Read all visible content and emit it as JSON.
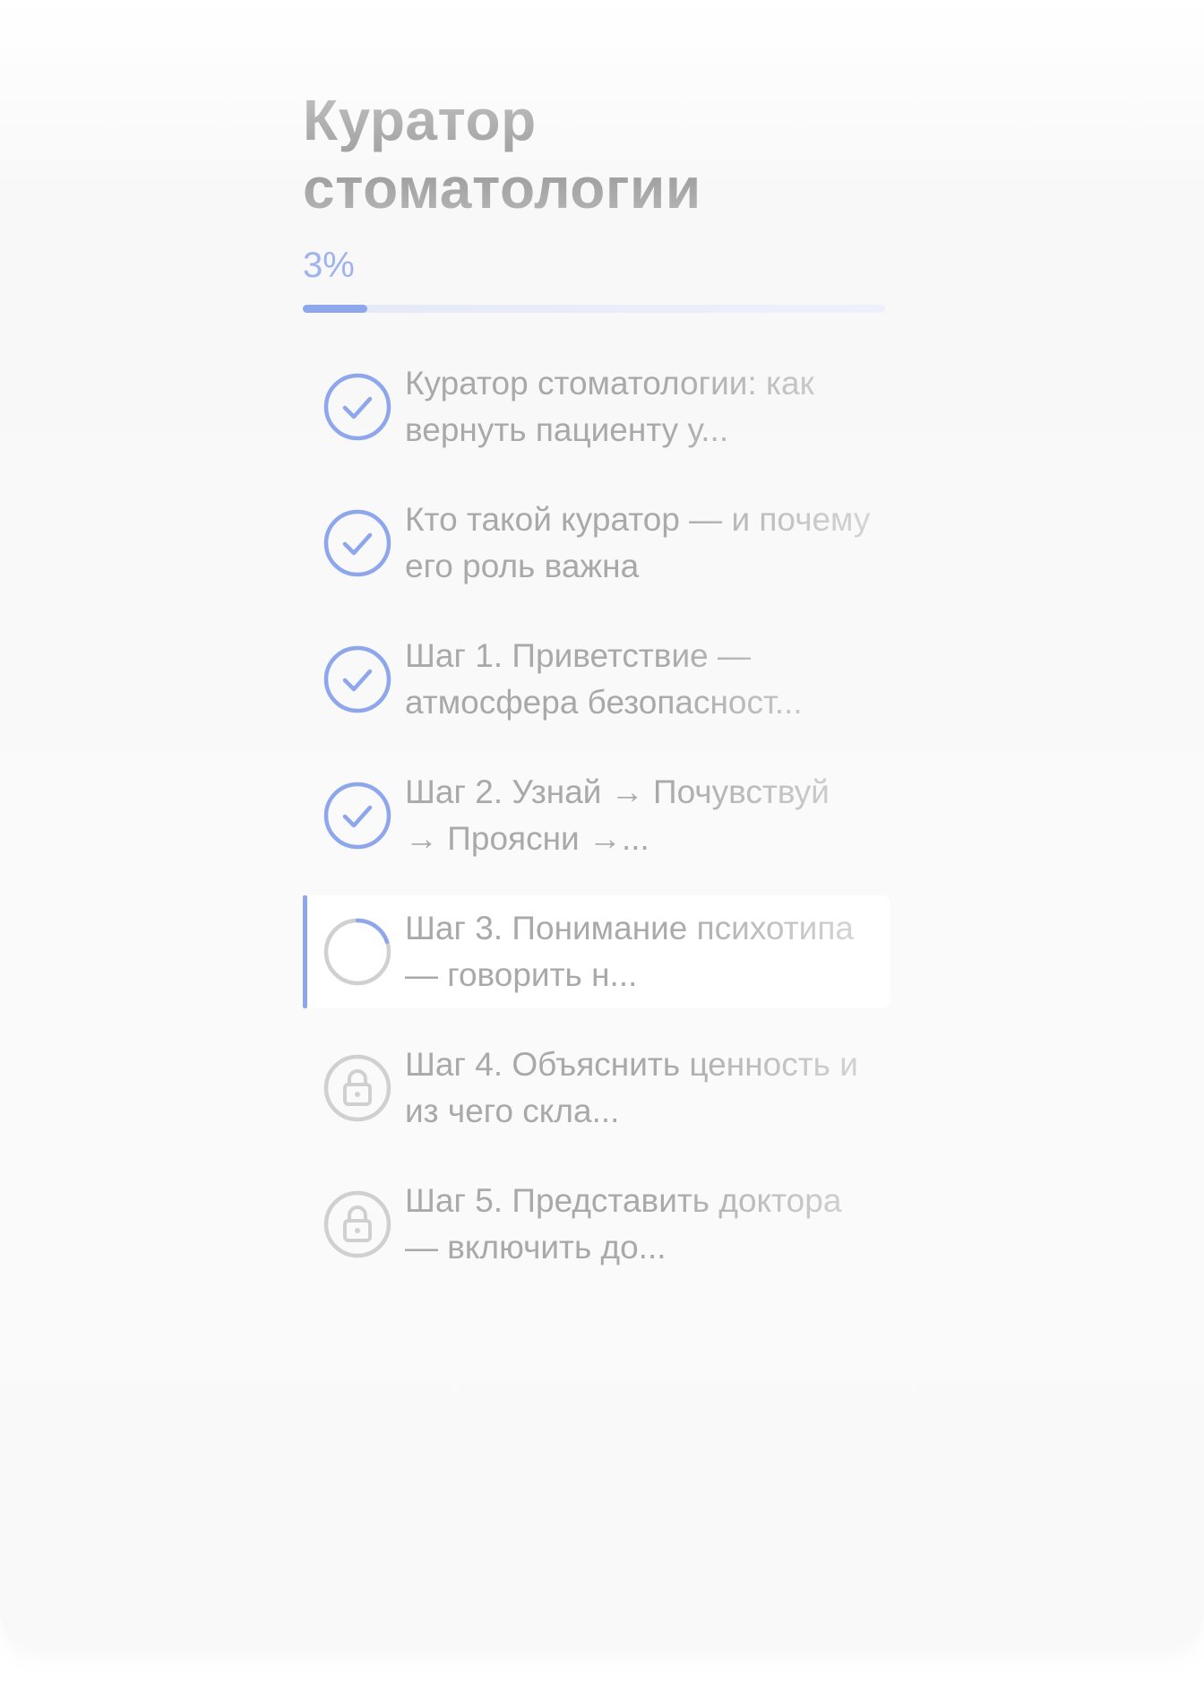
{
  "course": {
    "title": "Куратор стоматологии",
    "progress_label": "3%",
    "progress_fraction": 0.11
  },
  "colors": {
    "accent": "#8da6ec",
    "muted_text": "#a9a9a9",
    "locked_icon": "#d0d0d0"
  },
  "lessons": [
    {
      "status": "completed",
      "icon": "check-circle-icon",
      "title": "Куратор стоматологии: как вернуть пациенту у..."
    },
    {
      "status": "completed",
      "icon": "check-circle-icon",
      "title": "Кто такой куратор — и почему его роль важна"
    },
    {
      "status": "completed",
      "icon": "check-circle-icon",
      "title": "Шаг 1. Приветствие — атмосфера безопасност..."
    },
    {
      "status": "completed",
      "icon": "check-circle-icon",
      "title": "Шаг 2. Узнай → Почувствуй → Проясни →..."
    },
    {
      "status": "in-progress",
      "icon": "progress-ring-icon",
      "title": "Шаг 3. Понимание психотипа — говорить н..."
    },
    {
      "status": "locked",
      "icon": "lock-icon",
      "title": "Шаг 4. Объяснить ценность и из чего скла..."
    },
    {
      "status": "locked",
      "icon": "lock-icon",
      "title": "Шаг 5. Представить доктора — включить до..."
    }
  ]
}
